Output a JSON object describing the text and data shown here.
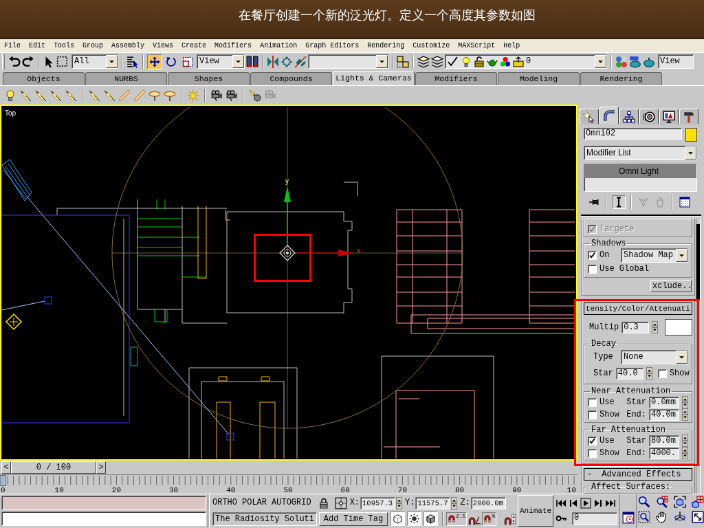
{
  "slide_title": "在餐厅创建一个新的泛光灯。定义一个高度其参数如图",
  "menu": [
    "File",
    "Edit",
    "Tools",
    "Group",
    "Assembly",
    "Views",
    "Create",
    "Modifiers",
    "Animation",
    "Graph Editors",
    "Rendering",
    "Customize",
    "MAXScript",
    "Help"
  ],
  "main_toolbar": {
    "selection_filter": "All",
    "transform_tools": [
      {
        "selected": true
      },
      {
        "selected": false
      },
      {
        "selected": false
      }
    ],
    "reference_coordinates": "View",
    "layer": "0",
    "render_type": "View"
  },
  "tabs": [
    {
      "label": "Objects",
      "selected": false
    },
    {
      "label": "NURBS",
      "selected": false
    },
    {
      "label": "Shapes",
      "selected": false
    },
    {
      "label": "Compounds",
      "selected": false
    },
    {
      "label": "Lights & Cameras",
      "selected": true
    },
    {
      "label": "Modifiers",
      "selected": false
    },
    {
      "label": "Modeling",
      "selected": false
    },
    {
      "label": "Rendering",
      "selected": false
    }
  ],
  "viewport": {
    "label": "Top",
    "axis_labels": [
      "y",
      "x"
    ]
  },
  "command_panel": {
    "tabs": [
      {
        "selected": false
      },
      {
        "selected": true
      },
      {
        "selected": false
      },
      {
        "selected": false
      },
      {
        "selected": false
      },
      {
        "selected": false
      }
    ],
    "object": {
      "name": "Omni02",
      "color": "#ffe000"
    },
    "modifier_list": "Modifier List",
    "stack": [
      {
        "label": "Omni Light",
        "selected": true
      }
    ],
    "stack_buttons": [
      {
        "on": false,
        "disabled": false
      },
      {
        "on": true,
        "disabled": false
      },
      {
        "on": false,
        "disabled": true
      },
      {
        "on": false,
        "disabled": true
      },
      {
        "on": false,
        "disabled": false
      }
    ],
    "targeted": {
      "label": "Targete",
      "checked": true,
      "disabled": true
    },
    "shadows": {
      "title": "Shadows",
      "on": {
        "label": "On",
        "checked": true
      },
      "type": "Shadow Map",
      "use_global": {
        "label": "Use Global",
        "checked": false
      },
      "exclude": "xclude.."
    },
    "intensity": {
      "header": "tensity/Color/Attenuati",
      "multiplier_label": "Multip",
      "multiplier": "0.3",
      "color": "#ffffff",
      "decay": {
        "title": "Decay",
        "type_label": "Type",
        "type": "None",
        "start_label": "Star",
        "start": "40.0",
        "show": {
          "label": "Show",
          "checked": false
        }
      },
      "attenuation": [
        {
          "title": "Near Attenuation",
          "use": {
            "label": "Use",
            "checked": false
          },
          "show": {
            "label": "Show",
            "checked": false
          },
          "start_label": "Star",
          "start": "0.0mm",
          "end_label": "End:",
          "end": "40.0m"
        },
        {
          "title": "Far Attenuation",
          "use": {
            "label": "Use",
            "checked": true
          },
          "show": {
            "label": "Show",
            "checked": false
          },
          "start_label": "Star",
          "start": "80.0m",
          "end_label": "End:",
          "end": "4000."
        }
      ]
    },
    "advanced": {
      "toggle": "-",
      "header": "Advanced Effects",
      "group": "Affect Surfaces:"
    }
  },
  "time_slider": {
    "previous": "<",
    "position": "0 / 100",
    "next": ">",
    "level": 0
  },
  "track_bar": {
    "labels": [
      "0",
      "10",
      "20",
      "30",
      "40",
      "50",
      "60",
      "70",
      "80",
      "90",
      "10"
    ]
  },
  "status": {
    "modes": [
      "ORTHO",
      "POLAR",
      "AUTOGRID"
    ],
    "coordinates": [
      {
        "label": "X:",
        "value": "10957.3"
      },
      {
        "label": "Y:",
        "value": "11575.7"
      },
      {
        "label": "Z:",
        "value": "2000.0m"
      }
    ],
    "radiosity": "The Radiosity Soluti",
    "time_tag": "Add Time Tag",
    "snap_marks": [
      "2.5",
      "%"
    ],
    "animate": "Animate",
    "frame": "0"
  }
}
